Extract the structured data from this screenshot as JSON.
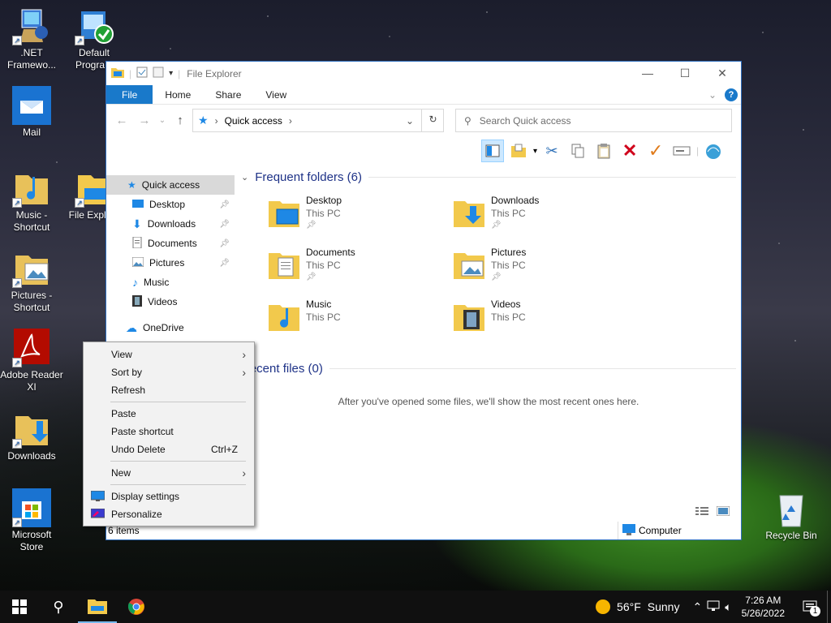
{
  "desktop": {
    "icons": [
      {
        "label": ".NET Framewo..."
      },
      {
        "label": "Default Progra..."
      },
      {
        "label": "Mail"
      },
      {
        "label": "Music - Shortcut"
      },
      {
        "label": "File Explo..."
      },
      {
        "label": "Pictures - Shortcut"
      },
      {
        "label": "Adobe Reader XI"
      },
      {
        "label": "Downloads"
      },
      {
        "label": "Microsoft Store"
      },
      {
        "label": "Recycle Bin"
      }
    ]
  },
  "explorer": {
    "title": "File Explorer",
    "tabs": [
      "File",
      "Home",
      "Share",
      "View"
    ],
    "address": {
      "location": "Quick access"
    },
    "search": {
      "placeholder": "Search Quick access"
    },
    "nav": [
      {
        "label": "Quick access",
        "pinned": false
      },
      {
        "label": "Desktop",
        "pinned": true
      },
      {
        "label": "Downloads",
        "pinned": true
      },
      {
        "label": "Documents",
        "pinned": true
      },
      {
        "label": "Pictures",
        "pinned": true
      },
      {
        "label": "Music",
        "pinned": false
      },
      {
        "label": "Videos",
        "pinned": false
      },
      {
        "label": "OneDrive",
        "pinned": false
      }
    ],
    "frequent_header": "Frequent folders (6)",
    "folders": [
      {
        "name": "Desktop",
        "location": "This PC"
      },
      {
        "name": "Downloads",
        "location": "This PC"
      },
      {
        "name": "Documents",
        "location": "This PC"
      },
      {
        "name": "Pictures",
        "location": "This PC"
      },
      {
        "name": "Music",
        "location": "This PC"
      },
      {
        "name": "Videos",
        "location": "This PC"
      }
    ],
    "recent_header": "Recent files (0)",
    "recent_empty": "After you've opened some files, we'll show the most recent ones here.",
    "status": {
      "count": "6 items",
      "location": "Computer"
    }
  },
  "context_menu": {
    "items": [
      {
        "label": "View"
      },
      {
        "label": "Sort by"
      },
      {
        "label": "Refresh"
      },
      {
        "label": "Paste"
      },
      {
        "label": "Paste shortcut"
      },
      {
        "label": "Undo Delete",
        "shortcut": "Ctrl+Z"
      },
      {
        "label": "New"
      },
      {
        "label": "Display settings"
      },
      {
        "label": "Personalize"
      }
    ]
  },
  "taskbar": {
    "weather": {
      "temp": "56°F",
      "condition": "Sunny"
    },
    "time": "7:26 AM",
    "date": "5/26/2022",
    "notification_count": "1"
  },
  "colors": {
    "accent": "#1979ca",
    "section_heading": "#1e3287",
    "taskbar": "#101010"
  }
}
